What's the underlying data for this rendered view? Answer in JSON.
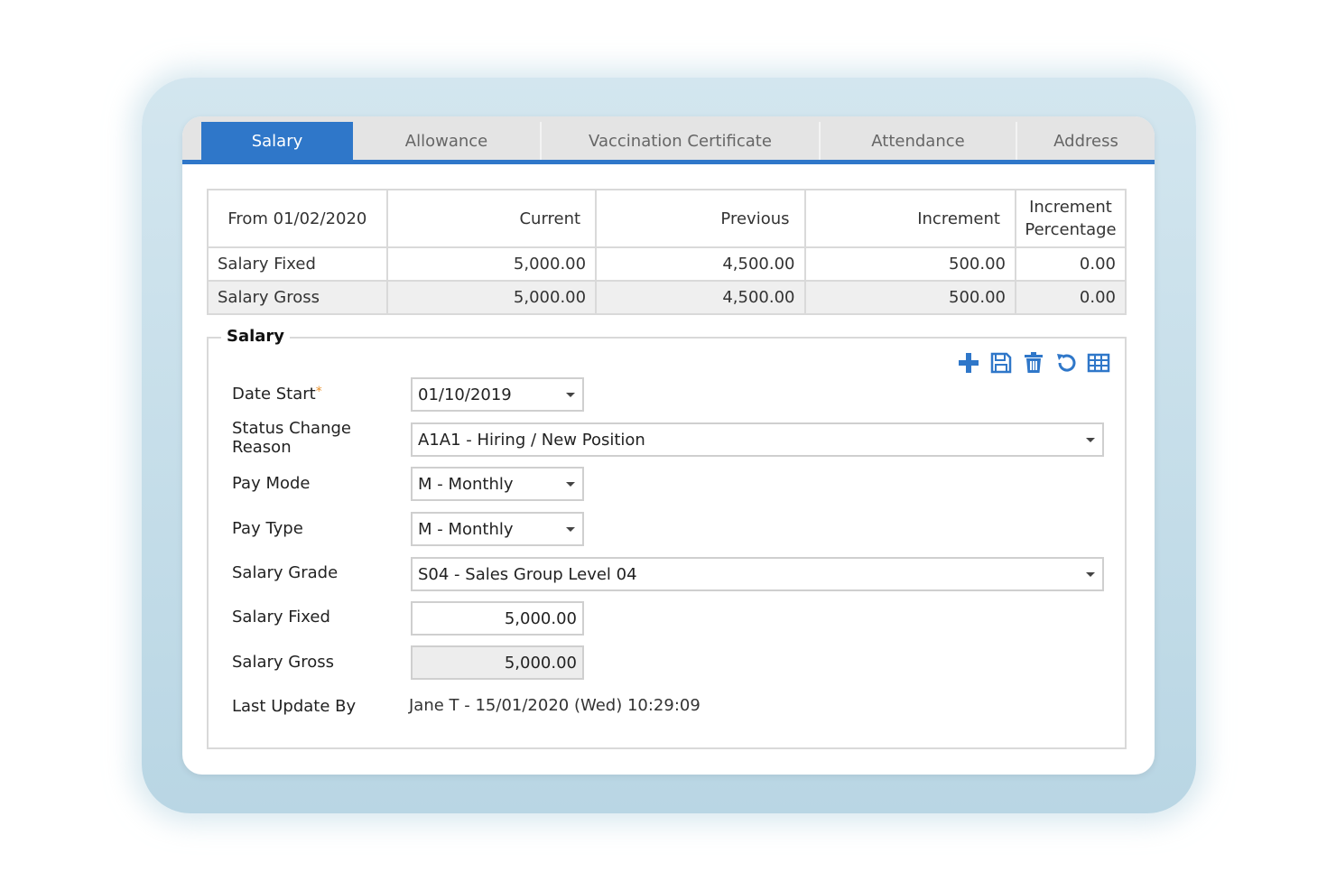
{
  "tabs": [
    {
      "label": "Salary",
      "active": true
    },
    {
      "label": "Allowance",
      "active": false
    },
    {
      "label": "Vaccination Certificate",
      "active": false
    },
    {
      "label": "Attendance",
      "active": false
    },
    {
      "label": "Address",
      "active": false
    }
  ],
  "summary": {
    "headers": [
      "From 01/02/2020",
      "Current",
      "Previous",
      "Increment",
      "Increment Percentage"
    ],
    "rows": [
      {
        "label": "Salary Fixed",
        "current": "5,000.00",
        "previous": "4,500.00",
        "increment": "500.00",
        "percentage": "0.00"
      },
      {
        "label": "Salary Gross",
        "current": "5,000.00",
        "previous": "4,500.00",
        "increment": "500.00",
        "percentage": "0.00"
      }
    ]
  },
  "salary_form": {
    "legend": "Salary",
    "toolbar_icons": [
      "add-icon",
      "save-icon",
      "delete-icon",
      "undo-icon",
      "grid-icon"
    ],
    "date_start": {
      "label": "Date Start",
      "required_mark": "*",
      "value": "01/10/2019"
    },
    "status_change_reason": {
      "label": "Status Change Reason",
      "value": "A1A1 - Hiring / New Position"
    },
    "pay_mode": {
      "label": "Pay Mode",
      "value": "M - Monthly"
    },
    "pay_type": {
      "label": "Pay Type",
      "value": "M - Monthly"
    },
    "salary_grade": {
      "label": "Salary Grade",
      "value": "S04 - Sales Group Level 04"
    },
    "salary_fixed": {
      "label": "Salary Fixed",
      "value": "5,000.00"
    },
    "salary_gross": {
      "label": "Salary Gross",
      "value": "5,000.00"
    },
    "last_update": {
      "label": "Last Update By",
      "value": "Jane T - 15/01/2020 (Wed) 10:29:09"
    }
  },
  "colors": {
    "accent": "#2f77c9",
    "required": "#e8912d",
    "frame": "#c4dde9"
  }
}
